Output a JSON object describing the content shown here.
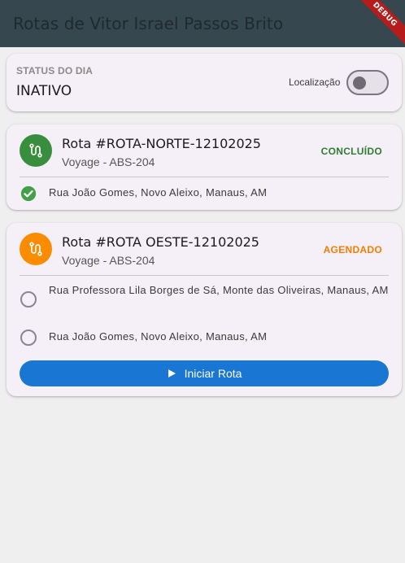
{
  "appbar": {
    "title": "Rotas de Vitor Israel Passos Brito",
    "debug_label": "DEBUG"
  },
  "status": {
    "label": "STATUS DO DIA",
    "value": "INATIVO",
    "location_label": "Localização",
    "location_enabled": false
  },
  "routes": [
    {
      "title": "Rota #ROTA-NORTE-12102025",
      "vehicle": "Voyage - ABS-204",
      "status": "CONCLUÍDO",
      "status_color": "#2e7d32",
      "avatar_color": "#388e3c",
      "icon": "route-icon",
      "stops": [
        {
          "address": "Rua João Gomes, Novo Aleixo, Manaus, AM",
          "done": true
        }
      ]
    },
    {
      "title": "Rota #ROTA OESTE-12102025",
      "vehicle": "Voyage - ABS-204",
      "status": "AGENDADO",
      "status_color": "#f57c00",
      "avatar_color": "#fb8c00",
      "icon": "route-icon",
      "stops": [
        {
          "address": "Rua Professora Lila Borges de Sá, Monte das Oliveiras, Manaus, AM",
          "done": false
        },
        {
          "address": "Rua João Gomes, Novo Aleixo, Manaus, AM",
          "done": false
        }
      ],
      "action_label": "Iniciar Rota"
    }
  ],
  "colors": {
    "primary": "#1976d2",
    "check": "#43a047"
  }
}
